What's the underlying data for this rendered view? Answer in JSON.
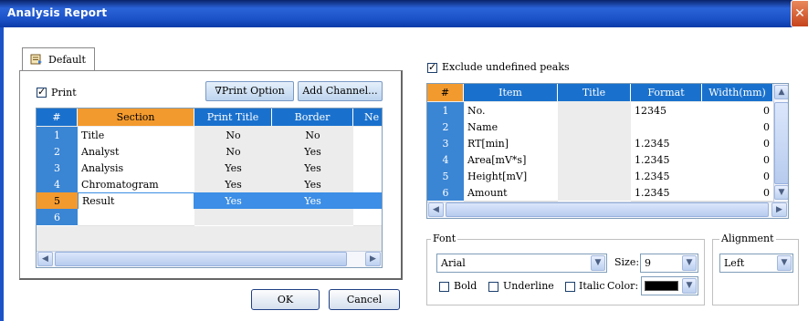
{
  "window": {
    "title": "Analysis Report",
    "close_glyph": "✕"
  },
  "tab": {
    "label": "Default",
    "icon": "report-icon"
  },
  "print": {
    "label": "Print",
    "checked": true
  },
  "buttons": {
    "print_option": "∇Print Option",
    "add_channel": "Add Channel...",
    "ok": "OK",
    "cancel": "Cancel"
  },
  "section_table": {
    "headers": [
      "#",
      "Section",
      "Print Title",
      "Border",
      "Ne"
    ],
    "rows": [
      {
        "num": "1",
        "section": "Title",
        "print_title": "No",
        "border": "No"
      },
      {
        "num": "2",
        "section": "Analyst",
        "print_title": "No",
        "border": "Yes"
      },
      {
        "num": "3",
        "section": "Analysis",
        "print_title": "Yes",
        "border": "Yes"
      },
      {
        "num": "4",
        "section": "Chromatogram",
        "print_title": "Yes",
        "border": "Yes"
      },
      {
        "num": "5",
        "section": "Result",
        "print_title": "Yes",
        "border": "Yes"
      },
      {
        "num": "6",
        "section": "",
        "print_title": "",
        "border": ""
      }
    ],
    "selected_row": 4
  },
  "exclude": {
    "label": "Exclude undefined peaks",
    "checked": true
  },
  "item_table": {
    "headers": [
      "#",
      "Item",
      "Title",
      "Format",
      "Width(mm)"
    ],
    "rows": [
      {
        "num": "1",
        "item": "No.",
        "title": "",
        "format": "12345",
        "width": "0"
      },
      {
        "num": "2",
        "item": "Name",
        "title": "",
        "format": "",
        "width": "0"
      },
      {
        "num": "3",
        "item": "RT[min]",
        "title": "",
        "format": "1.2345",
        "width": "0"
      },
      {
        "num": "4",
        "item": "Area[mV*s]",
        "title": "",
        "format": "1.2345",
        "width": "0"
      },
      {
        "num": "5",
        "item": "Height[mV]",
        "title": "",
        "format": "1.2345",
        "width": "0"
      },
      {
        "num": "6",
        "item": "Amount",
        "title": "",
        "format": "1.2345",
        "width": "0"
      }
    ]
  },
  "font_group": {
    "label": "Font",
    "font_value": "Arial",
    "size_label": "Size:",
    "size_value": "9",
    "bold": "Bold",
    "underline": "Underline",
    "italic": "Italic",
    "color_label": "Color:",
    "color_value": "#000000"
  },
  "alignment_group": {
    "label": "Alignment",
    "value": "Left"
  }
}
